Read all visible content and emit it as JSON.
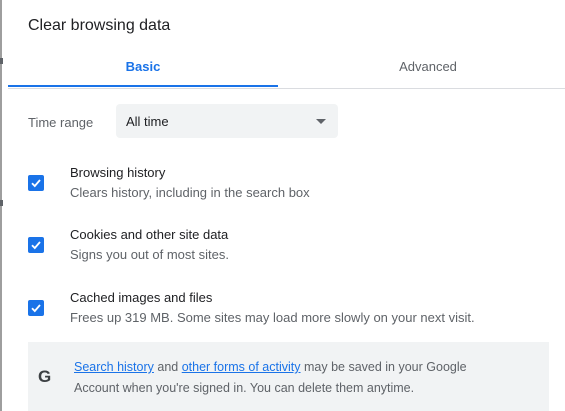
{
  "dialog": {
    "title": "Clear browsing data"
  },
  "tabs": [
    {
      "label": "Basic",
      "selected": true
    },
    {
      "label": "Advanced",
      "selected": false
    }
  ],
  "time_range": {
    "label": "Time range",
    "selected": "All time"
  },
  "options": [
    {
      "title": "Browsing history",
      "description": "Clears history, including in the search box",
      "checked": true
    },
    {
      "title": "Cookies and other site data",
      "description": "Signs you out of most sites.",
      "checked": true
    },
    {
      "title": "Cached images and files",
      "description": "Frees up 319 MB. Some sites may load more slowly on your next visit.",
      "checked": true
    }
  ],
  "info": {
    "icon": "google-g-icon",
    "icon_glyph": "G",
    "link1": "Search history",
    "text1": " and ",
    "link2": "other forms of activity",
    "text2": " may be saved in your Google",
    "line2": "Account when you're signed in. You can delete them anytime."
  },
  "colors": {
    "accent": "#1a73e8",
    "info_background": "#f1f3f4",
    "secondary_text": "#5f6368"
  }
}
